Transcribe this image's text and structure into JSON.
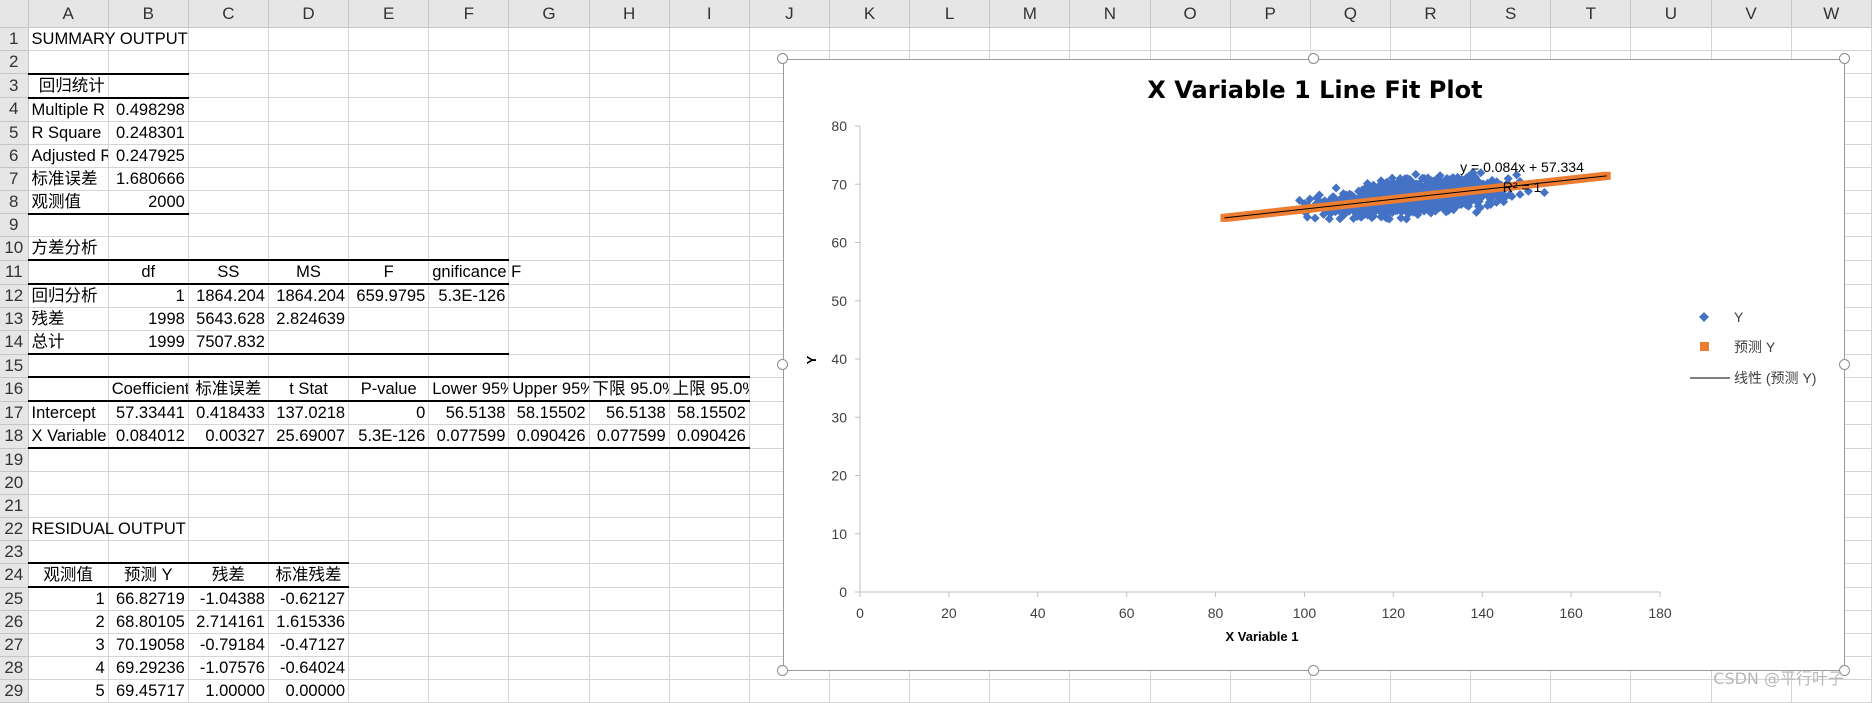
{
  "columns": [
    "A",
    "B",
    "C",
    "D",
    "E",
    "F",
    "G",
    "H",
    "I",
    "J",
    "K",
    "L",
    "M",
    "N",
    "O",
    "P",
    "Q",
    "R",
    "S",
    "T",
    "U",
    "V",
    "W"
  ],
  "rows": [
    "1",
    "2",
    "3",
    "4",
    "5",
    "6",
    "7",
    "8",
    "9",
    "10",
    "11",
    "12",
    "13",
    "14",
    "15",
    "16",
    "17",
    "18",
    "19",
    "20",
    "21",
    "22",
    "23",
    "24",
    "25",
    "26",
    "27",
    "28",
    "29"
  ],
  "summary": {
    "title": "SUMMARY OUTPUT",
    "reg_header": "回归统计",
    "stats": [
      {
        "label": "Multiple R",
        "value": "0.498298"
      },
      {
        "label": "R Square",
        "value": "0.248301"
      },
      {
        "label": "Adjusted R",
        "value": "0.247925"
      },
      {
        "label": "标准误差",
        "value": "1.680666"
      },
      {
        "label": "观测值",
        "value": "2000"
      }
    ]
  },
  "anova": {
    "title": "方差分析",
    "headers": [
      "",
      "df",
      "SS",
      "MS",
      "F",
      "gnificance F"
    ],
    "rows": [
      [
        "回归分析",
        "1",
        "1864.204",
        "1864.204",
        "659.9795",
        "5.3E-126"
      ],
      [
        "残差",
        "1998",
        "5643.628",
        "2.824639",
        "",
        ""
      ],
      [
        "总计",
        "1999",
        "7507.832",
        "",
        "",
        ""
      ]
    ]
  },
  "coef": {
    "headers": [
      "",
      "Coefficient",
      "标准误差",
      "t Stat",
      "P-value",
      "Lower 95%",
      "Upper 95%",
      "下限 95.0%",
      "上限 95.0%"
    ],
    "rows": [
      [
        "Intercept",
        "57.33441",
        "0.418433",
        "137.0218",
        "0",
        "56.5138",
        "58.15502",
        "56.5138",
        "58.15502"
      ],
      [
        "X Variable",
        "0.084012",
        "0.00327",
        "25.69007",
        "5.3E-126",
        "0.077599",
        "0.090426",
        "0.077599",
        "0.090426"
      ]
    ]
  },
  "residual": {
    "title": "RESIDUAL OUTPUT",
    "headers": [
      "观测值",
      "预测 Y",
      "残差",
      "标准残差"
    ],
    "rows": [
      [
        "1",
        "66.82719",
        "-1.04388",
        "-0.62127"
      ],
      [
        "2",
        "68.80105",
        "2.714161",
        "1.615336"
      ],
      [
        "3",
        "70.19058",
        "-0.79184",
        "-0.47127"
      ],
      [
        "4",
        "69.29236",
        "-1.07576",
        "-0.64024"
      ],
      [
        "5",
        "69.45717",
        "1.00000",
        "0.00000"
      ]
    ]
  },
  "chart_data": {
    "type": "scatter",
    "title": "X Variable 1 Line Fit  Plot",
    "xlabel": "X Variable 1",
    "ylabel": "Y",
    "xlim": [
      0,
      180
    ],
    "ylim": [
      0,
      80
    ],
    "xticks": [
      "0",
      "20",
      "40",
      "60",
      "80",
      "100",
      "120",
      "140",
      "160",
      "180"
    ],
    "yticks": [
      "0",
      "10",
      "20",
      "30",
      "40",
      "50",
      "60",
      "70",
      "80"
    ],
    "grid": false,
    "legend_position": "right",
    "legend": [
      "Y",
      "预测 Y",
      "线性 (预测 Y)"
    ],
    "trendline": {
      "equation": "y = 0.084x + 57.334",
      "r2": "R² = 1",
      "slope": 0.084,
      "intercept": 57.334,
      "x_range": [
        82,
        168
      ]
    },
    "series": [
      {
        "name": "Y",
        "color": "#4472C4",
        "marker": "diamond",
        "x_range": [
          82,
          168
        ],
        "y_center_fn": "0.084x+57.334",
        "spread": 2.2
      },
      {
        "name": "预测 Y",
        "color": "#ED7D31",
        "marker": "square",
        "x_range": [
          82,
          168
        ],
        "y_center_fn": "0.084x+57.334",
        "spread": 0
      }
    ]
  },
  "watermark": "CSDN @平行叶子",
  "colors": {
    "header_bg": "#e6e6e6",
    "grid_line": "#d4d4d4",
    "series_y": "#4472C4",
    "series_pred": "#ED7D31"
  }
}
